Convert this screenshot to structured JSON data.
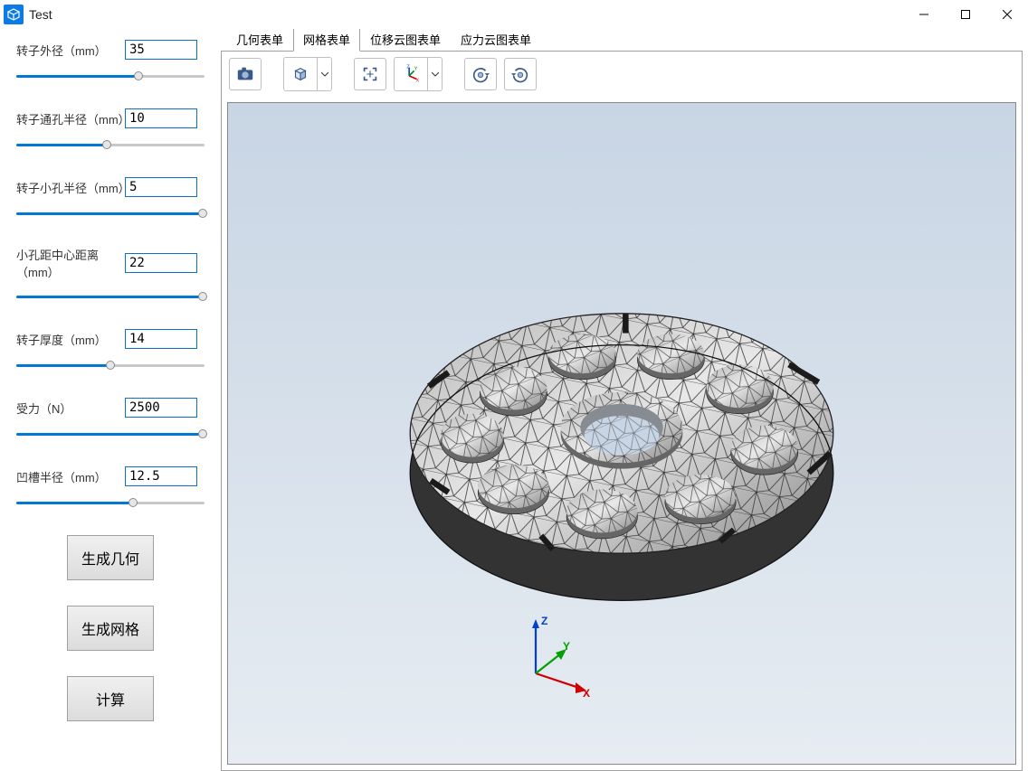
{
  "window": {
    "title": "Test"
  },
  "params": [
    {
      "label": "转子外径（mm）",
      "value": "35",
      "pct": 65
    },
    {
      "label": "转子通孔半径（mm）",
      "value": "10",
      "pct": 48
    },
    {
      "label": "转子小孔半径（mm）",
      "value": "5",
      "pct": 99
    },
    {
      "label": "小孔距中心距离（mm）",
      "value": "22",
      "pct": 99
    },
    {
      "label": "转子厚度（mm）",
      "value": "14",
      "pct": 50
    },
    {
      "label": "受力（N）",
      "value": "2500",
      "pct": 99
    },
    {
      "label": "凹槽半径（mm）",
      "value": "12.5",
      "pct": 62
    }
  ],
  "buttons": {
    "gen_geometry": "生成几何",
    "gen_mesh": "生成网格",
    "compute": "计算"
  },
  "tabs": [
    {
      "label": "几何表单",
      "active": false
    },
    {
      "label": "网格表单",
      "active": true
    },
    {
      "label": "位移云图表单",
      "active": false
    },
    {
      "label": "应力云图表单",
      "active": false
    }
  ],
  "toolbar": {
    "camera": "camera-icon",
    "viewcube": "viewcube-icon",
    "fit": "fit-icon",
    "axes": "axes-icon",
    "rotate_left": "rotate-left-icon",
    "rotate_right": "rotate-right-icon"
  },
  "axis_labels": {
    "x": "X",
    "y": "Y",
    "z": "Z"
  }
}
